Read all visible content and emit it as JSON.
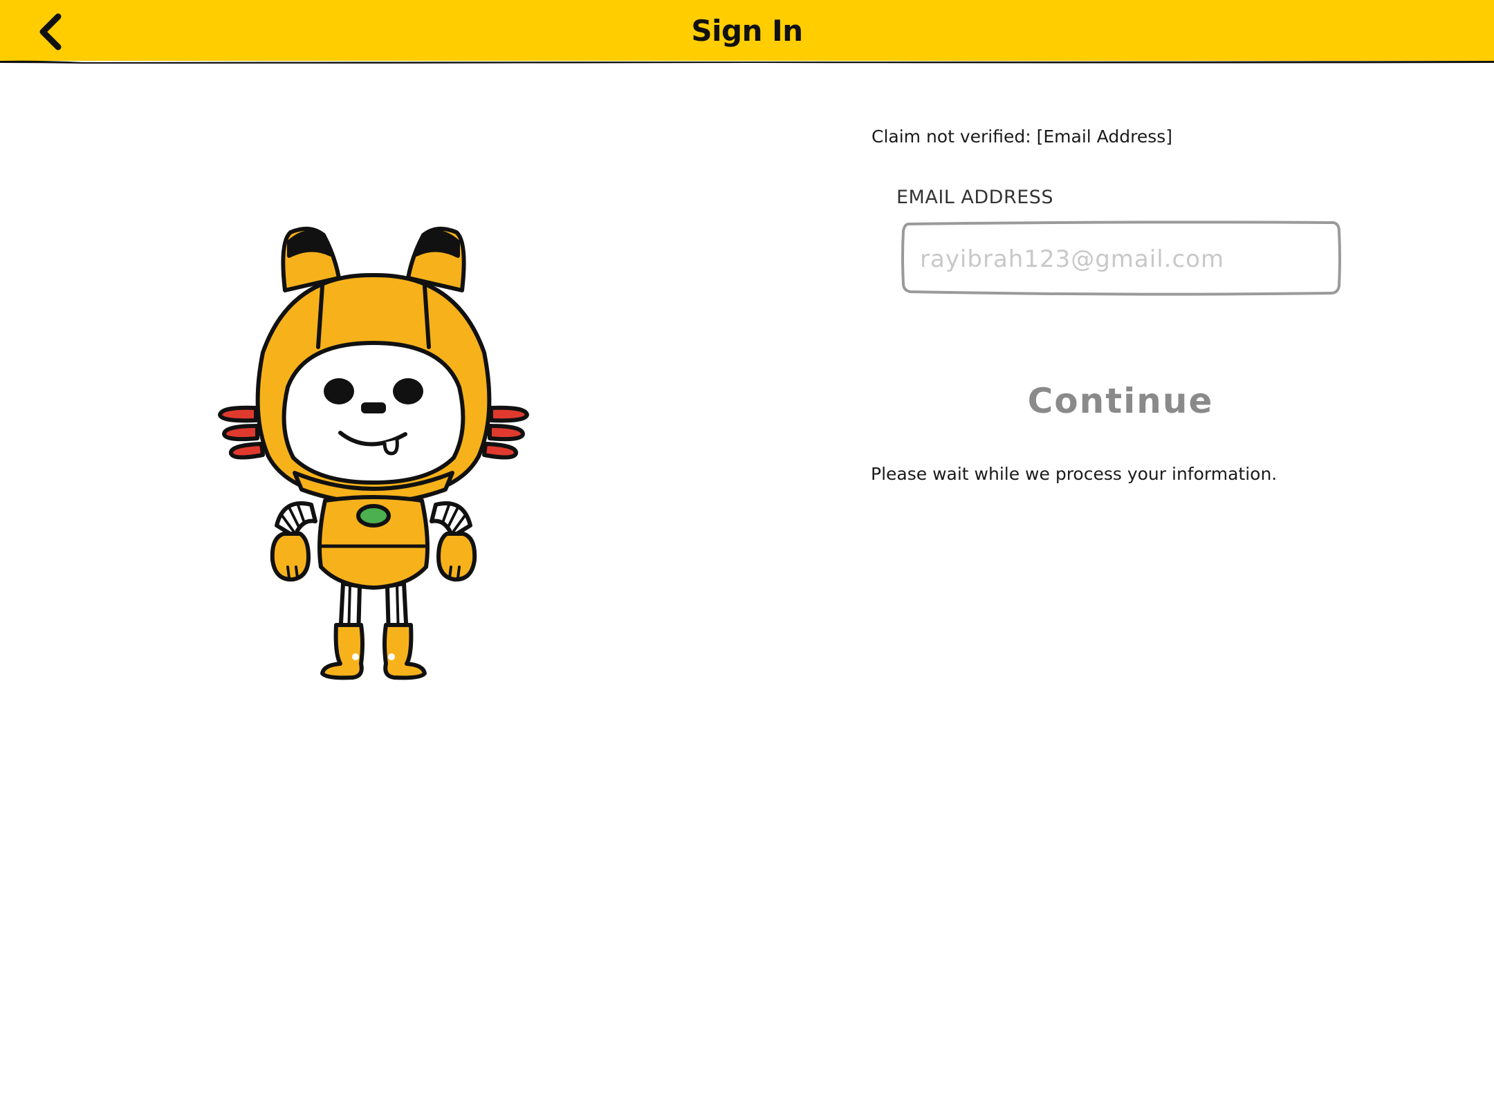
{
  "header": {
    "title": "Sign In",
    "back_icon": "chevron-left-icon",
    "background": "#ffcd00"
  },
  "status": {
    "claim_message": "Claim not verified: [Email Address]",
    "wait_message": "Please wait while we process your information."
  },
  "form": {
    "email_label": "EMAIL ADDRESS",
    "email_placeholder": "rayibrah123@gmail.com",
    "email_value": "",
    "continue_label": "Continue"
  },
  "illustration": {
    "name": "robot-cat-mascot",
    "primary_color": "#f7b21b",
    "accent_color": "#e03a2f",
    "chest_light_color": "#4caf50"
  }
}
